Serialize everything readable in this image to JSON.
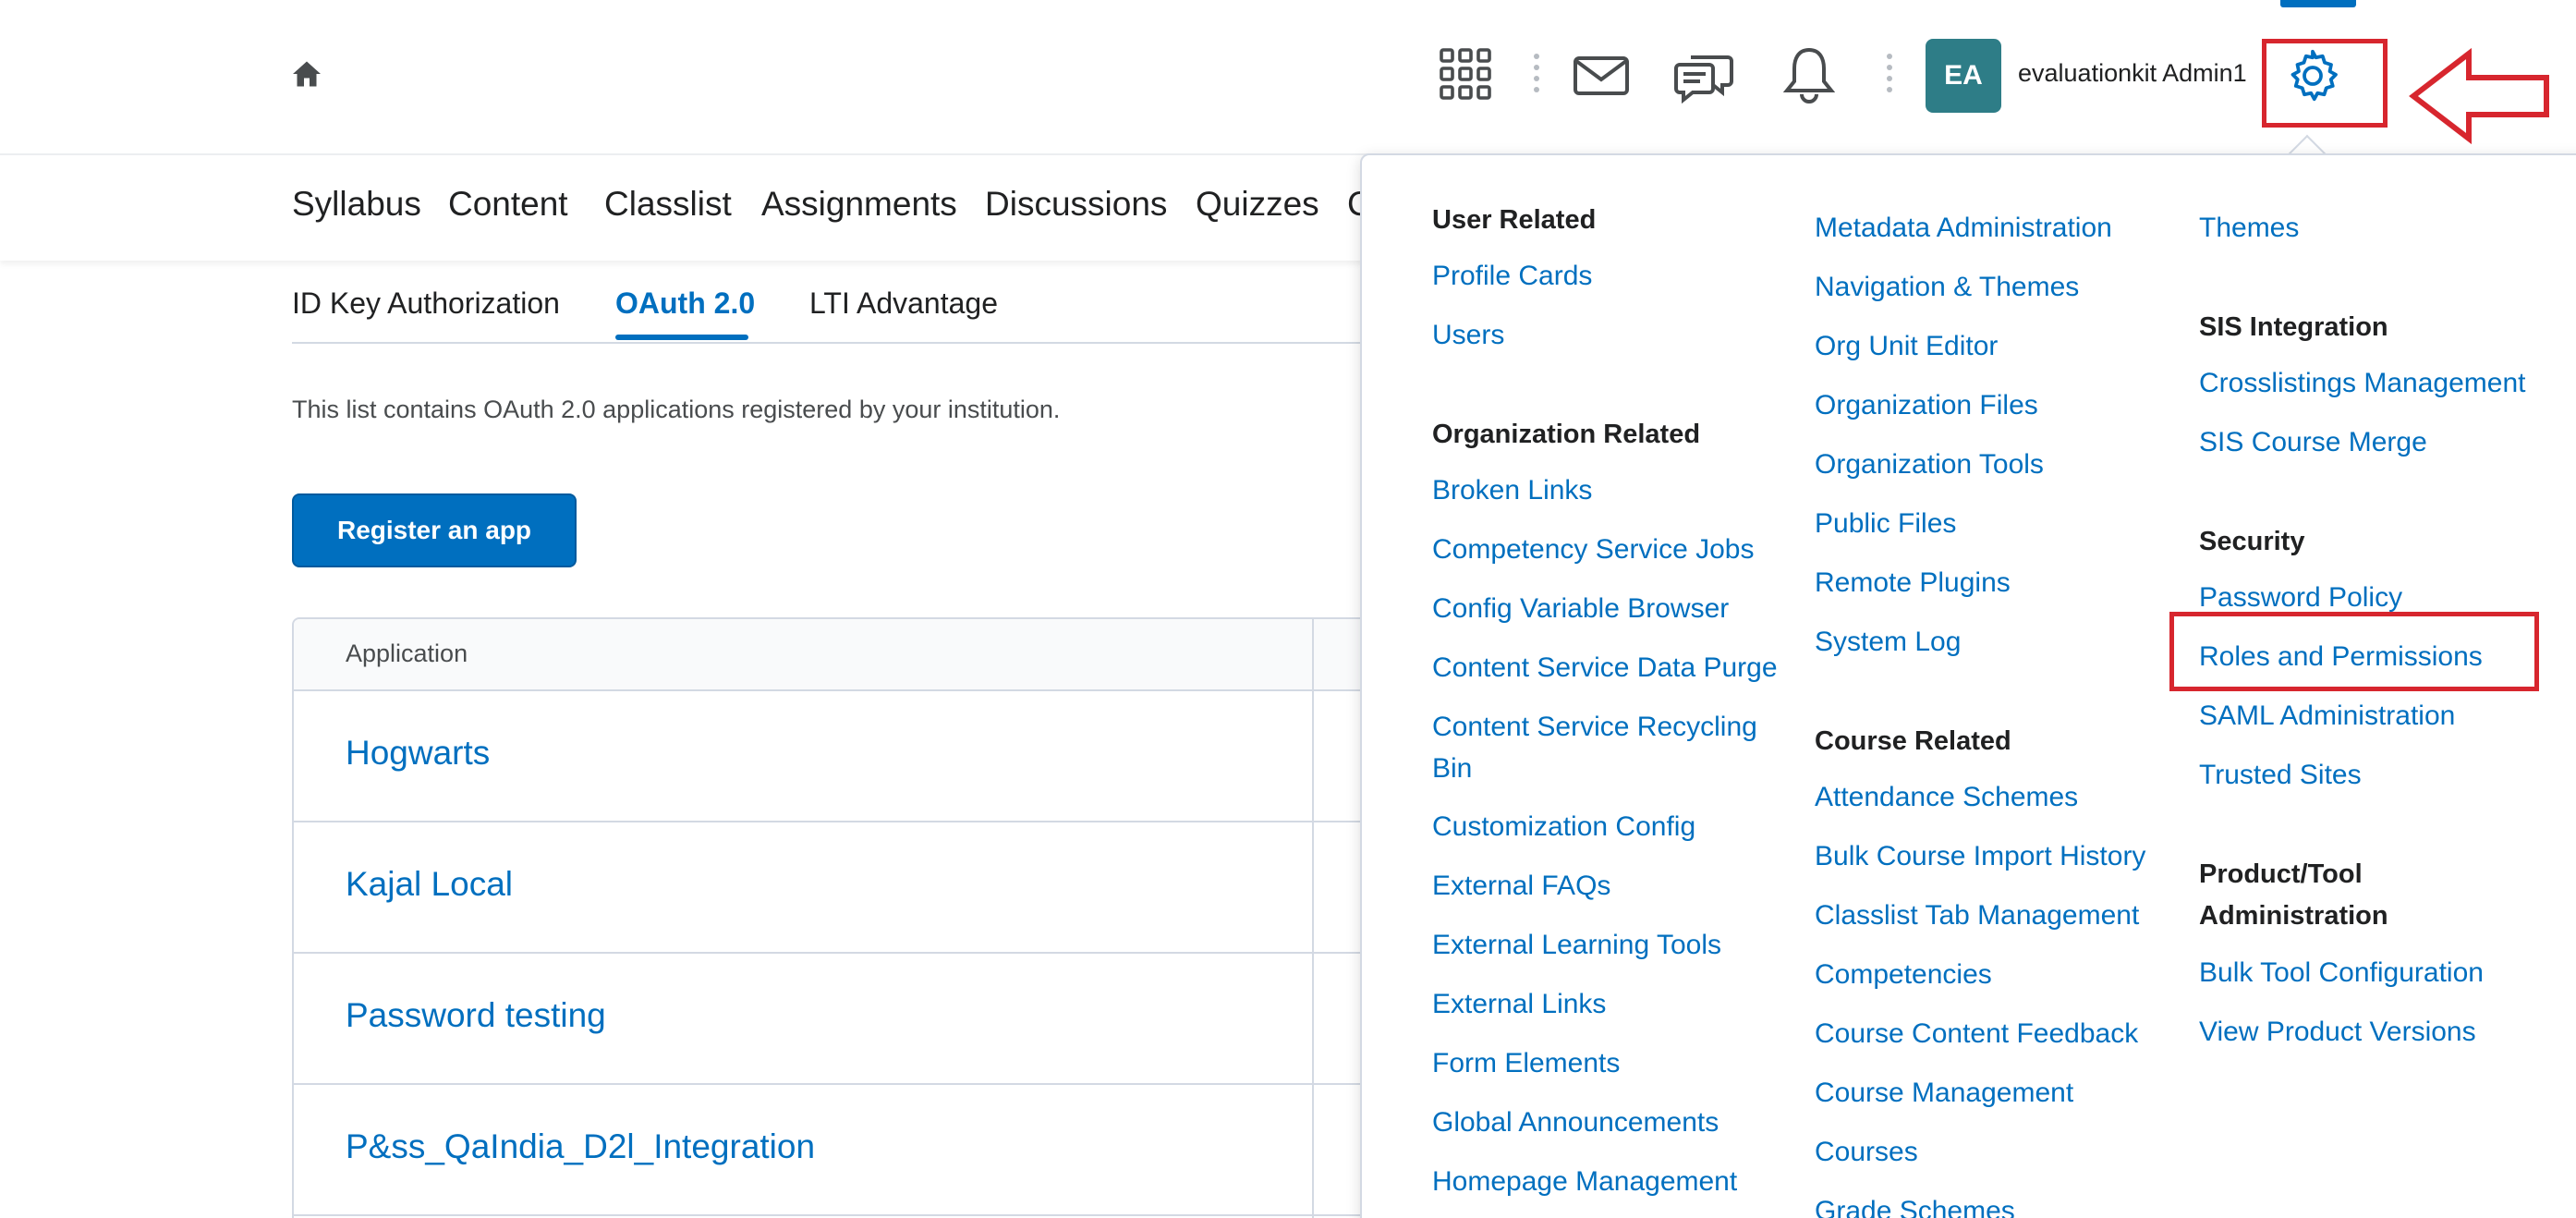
{
  "header": {
    "user_initials": "EA",
    "user_name": "evaluationkit Admin1",
    "icons": [
      "home-icon",
      "apps-grid-icon",
      "mail-icon",
      "chat-icon",
      "bell-icon",
      "gear-icon"
    ],
    "avatar_color": "#2e7d87",
    "accent_color": "#006fbf",
    "highlight_color": "#d7262e"
  },
  "navbar": {
    "items": [
      "Syllabus",
      "Content",
      "Classlist",
      "Assignments",
      "Discussions",
      "Quizzes",
      "C"
    ]
  },
  "tabs": [
    {
      "label": "ID Key Authorization",
      "active": false
    },
    {
      "label": "OAuth 2.0",
      "active": true
    },
    {
      "label": "LTI Advantage",
      "active": false
    }
  ],
  "description": "This list contains OAuth 2.0 applications registered by your institution.",
  "register_label": "Register an app",
  "table": {
    "header": "Application",
    "rows": [
      "Hogwarts",
      "Kajal Local",
      "Password testing",
      "P&ss_QaIndia_D2l_Integration"
    ]
  },
  "admin_menu": {
    "col1": {
      "user_related": {
        "heading": "User Related",
        "links": [
          "Profile Cards",
          "Users"
        ]
      },
      "org_related": {
        "heading": "Organization Related",
        "links": [
          "Broken Links",
          "Competency Service Jobs",
          "Config Variable Browser",
          "Content Service Data Purge",
          "Content Service Recycling",
          "Bin",
          "Customization Config",
          "External FAQs",
          "External Learning Tools",
          "External Links",
          "Form Elements",
          "Global Announcements",
          "Homepage Management"
        ]
      }
    },
    "col2": {
      "links_top": [
        "Metadata Administration",
        "Navigation & Themes",
        "Org Unit Editor",
        "Organization Files",
        "Organization Tools",
        "Public Files",
        "Remote Plugins",
        "System Log"
      ],
      "course_related": {
        "heading": "Course Related",
        "links": [
          "Attendance Schemes",
          "Bulk Course Import History",
          "Classlist Tab Management",
          "Competencies",
          "Course Content Feedback",
          "Course Management",
          "Courses",
          "Grade Schemes"
        ]
      }
    },
    "col3": {
      "links_top": [
        "Themes"
      ],
      "sis": {
        "heading": "SIS Integration",
        "links": [
          "Crosslistings Management",
          "SIS Course Merge"
        ]
      },
      "security": {
        "heading": "Security",
        "links": [
          "Password Policy",
          "Roles and Permissions",
          "SAML Administration",
          "Trusted Sites"
        ]
      },
      "product": {
        "heading_line1": "Product/Tool",
        "heading_line2": "Administration",
        "links": [
          "Bulk Tool Configuration",
          "View Product Versions"
        ]
      }
    }
  }
}
